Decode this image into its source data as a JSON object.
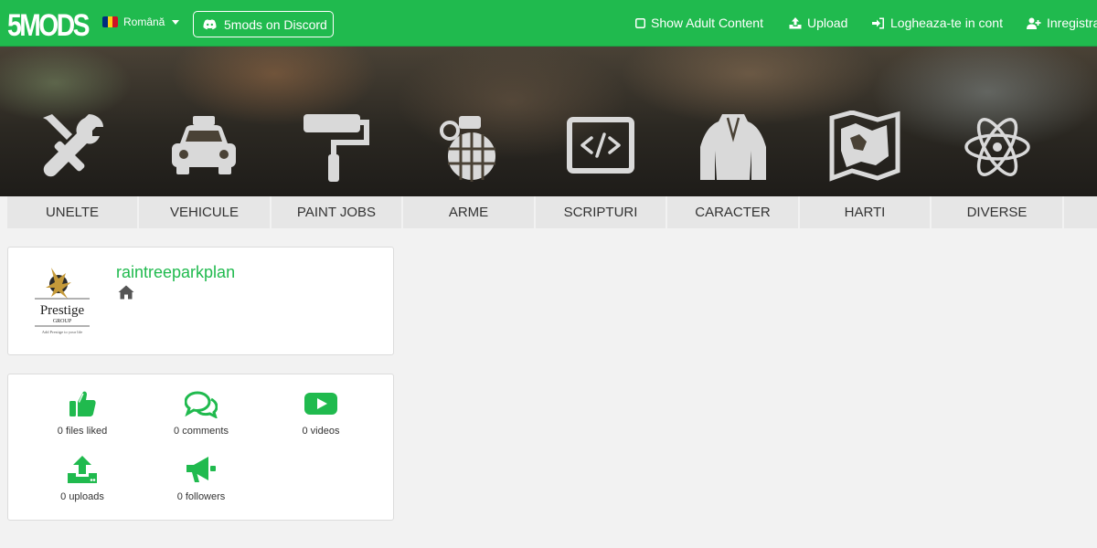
{
  "brand": {
    "logo_text": "5MODS"
  },
  "header": {
    "language": "Română",
    "discord_label": "5mods on Discord",
    "show_adult": "Show Adult Content",
    "upload": "Upload",
    "login": "Logheaza-te in cont",
    "register": "Inregistrare"
  },
  "categories": [
    {
      "label": "UNELTE",
      "icon": "tools-icon"
    },
    {
      "label": "VEHICULE",
      "icon": "car-icon"
    },
    {
      "label": "PAINT JOBS",
      "icon": "paint-roller-icon"
    },
    {
      "label": "ARME",
      "icon": "grenade-icon"
    },
    {
      "label": "SCRIPTURI",
      "icon": "code-icon"
    },
    {
      "label": "CARACTER",
      "icon": "jacket-icon"
    },
    {
      "label": "HARTI",
      "icon": "map-icon"
    },
    {
      "label": "DIVERSE",
      "icon": "atom-icon"
    }
  ],
  "profile": {
    "username": "raintreeparkplan",
    "avatar_logo": {
      "name": "Prestige",
      "sub": "GROUP",
      "tagline": "Add Prestige to your life"
    }
  },
  "stats": [
    {
      "label": "0 files liked",
      "icon": "thumbs-up-icon"
    },
    {
      "label": "0 comments",
      "icon": "comments-icon"
    },
    {
      "label": "0 videos",
      "icon": "youtube-icon"
    },
    {
      "label": "0 uploads",
      "icon": "upload-icon"
    },
    {
      "label": "0 followers",
      "icon": "megaphone-icon"
    }
  ],
  "colors": {
    "brand_green": "#20ba4e",
    "category_bg": "#e6e6e6",
    "page_bg": "#f2f2f2"
  }
}
